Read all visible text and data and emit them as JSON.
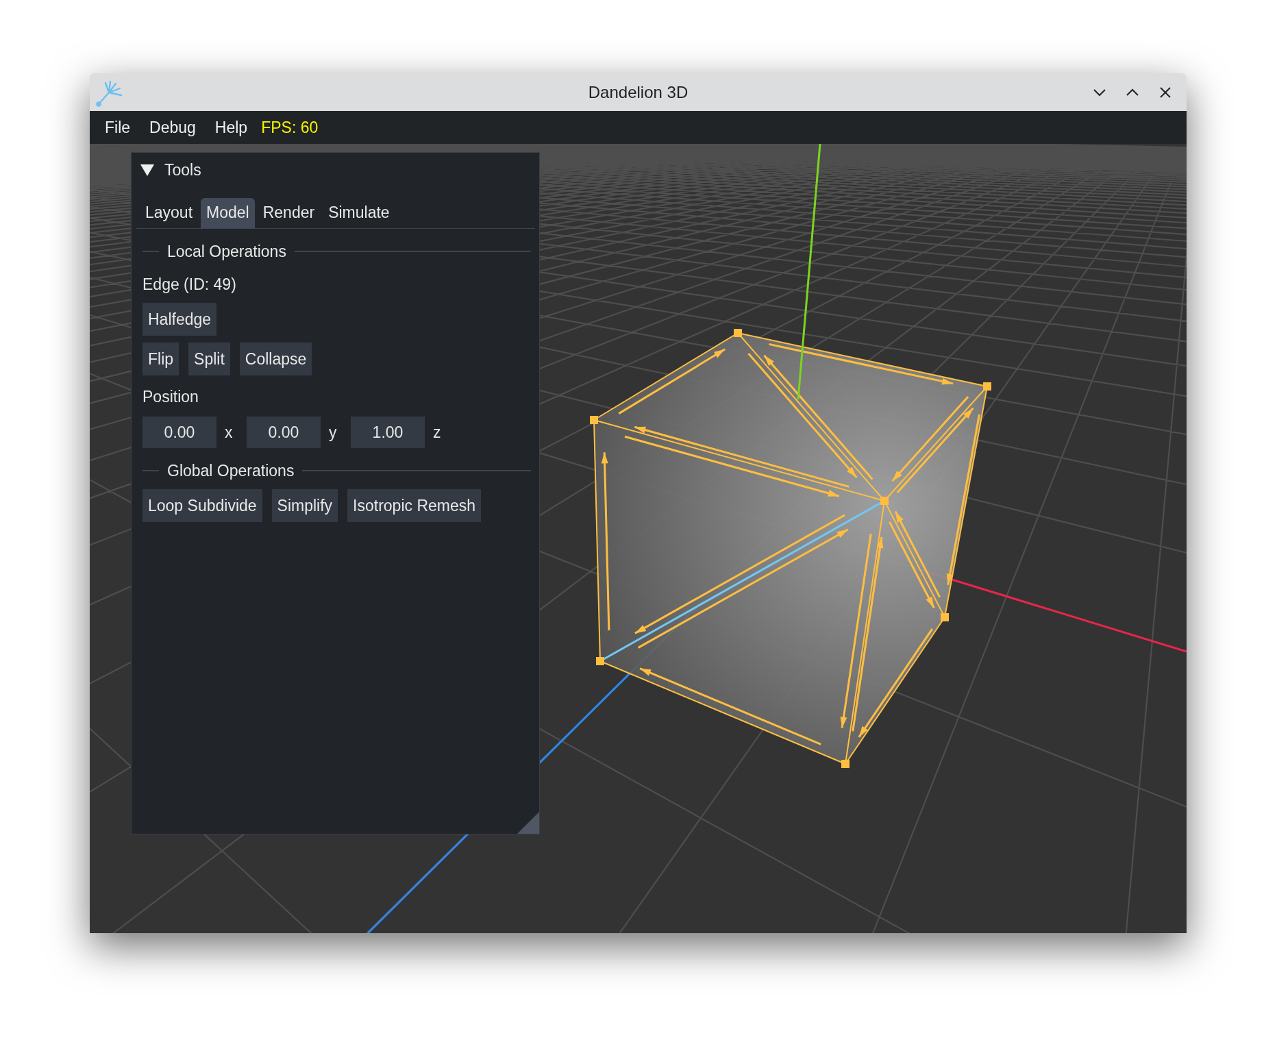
{
  "window": {
    "title": "Dandelion 3D"
  },
  "menu": [
    "File",
    "Debug",
    "Help"
  ],
  "fps": "FPS: 60",
  "tools_panel": {
    "title": "Tools",
    "expanded": true,
    "tabs": [
      {
        "label": "Layout",
        "selected": false
      },
      {
        "label": "Model",
        "selected": true
      },
      {
        "label": "Render",
        "selected": false
      },
      {
        "label": "Simulate",
        "selected": false
      }
    ],
    "sections": [
      {
        "title": "Local Operations",
        "items": [
          {
            "kind": "label",
            "text": "Edge (ID: 49)"
          },
          {
            "kind": "buttons",
            "buttons": [
              "Halfedge"
            ]
          },
          {
            "kind": "buttons",
            "buttons": [
              "Flip",
              "Split",
              "Collapse"
            ]
          },
          {
            "kind": "label",
            "text": "Position"
          },
          {
            "kind": "vector",
            "fields": [
              {
                "value": "0.00",
                "axis": "x"
              },
              {
                "value": "0.00",
                "axis": "y"
              },
              {
                "value": "1.00",
                "axis": "z"
              }
            ]
          }
        ]
      },
      {
        "title": "Global Operations",
        "items": [
          {
            "kind": "buttons",
            "buttons": [
              "Loop Subdivide",
              "Simplify",
              "Isotropic Remesh"
            ]
          }
        ]
      }
    ]
  }
}
